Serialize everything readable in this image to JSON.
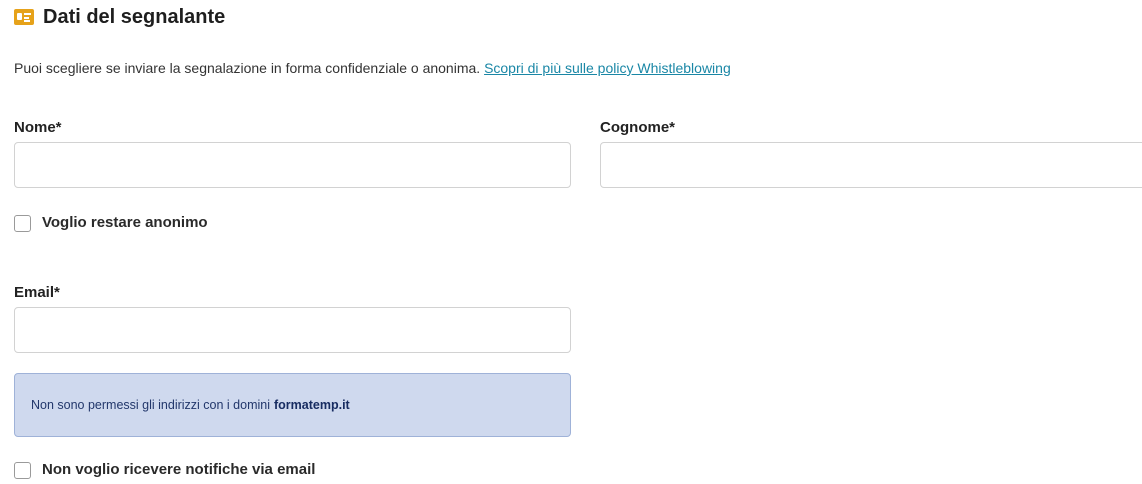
{
  "section": {
    "icon": "id-card-icon",
    "icon_color": "#e6a21a",
    "title": "Dati del segnalante"
  },
  "intro": {
    "text": "Puoi scegliere se inviare la segnalazione in forma confidenziale o anonima.",
    "link_label": "Scopri di più sulle policy Whistleblowing",
    "link_color": "#1a87a6"
  },
  "form": {
    "nome": {
      "label": "Nome*",
      "value": ""
    },
    "cognome": {
      "label": "Cognome*",
      "value": ""
    },
    "anonymous_checkbox": {
      "label": "Voglio restare anonimo",
      "checked": false
    },
    "email": {
      "label": "Email*",
      "value": ""
    },
    "notice": {
      "text": "Non sono permessi gli indirizzi con i domini",
      "domain": "formatemp.it",
      "background": "#cfd9ee"
    },
    "no_notifications_checkbox": {
      "label": "Non voglio ricevere notifiche via email",
      "checked": false
    }
  }
}
